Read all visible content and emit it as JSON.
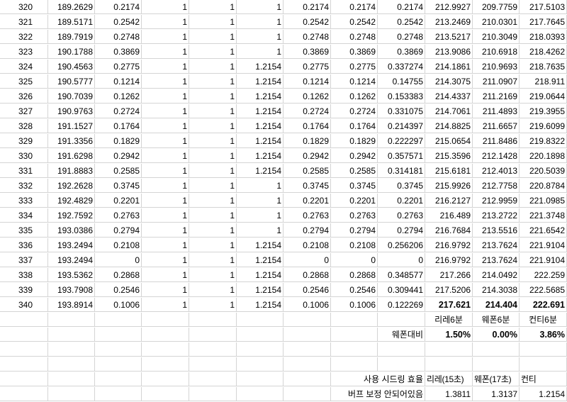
{
  "rows": [
    [
      "320",
      "189.2629",
      "0.2174",
      "1",
      "1",
      "1",
      "0.2174",
      "0.2174",
      "0.2174",
      "212.9927",
      "209.7759",
      "217.5103"
    ],
    [
      "321",
      "189.5171",
      "0.2542",
      "1",
      "1",
      "1",
      "0.2542",
      "0.2542",
      "0.2542",
      "213.2469",
      "210.0301",
      "217.7645"
    ],
    [
      "322",
      "189.7919",
      "0.2748",
      "1",
      "1",
      "1",
      "0.2748",
      "0.2748",
      "0.2748",
      "213.5217",
      "210.3049",
      "218.0393"
    ],
    [
      "323",
      "190.1788",
      "0.3869",
      "1",
      "1",
      "1",
      "0.3869",
      "0.3869",
      "0.3869",
      "213.9086",
      "210.6918",
      "218.4262"
    ],
    [
      "324",
      "190.4563",
      "0.2775",
      "1",
      "1",
      "1.2154",
      "0.2775",
      "0.2775",
      "0.337274",
      "214.1861",
      "210.9693",
      "218.7635"
    ],
    [
      "325",
      "190.5777",
      "0.1214",
      "1",
      "1",
      "1.2154",
      "0.1214",
      "0.1214",
      "0.14755",
      "214.3075",
      "211.0907",
      "218.911"
    ],
    [
      "326",
      "190.7039",
      "0.1262",
      "1",
      "1",
      "1.2154",
      "0.1262",
      "0.1262",
      "0.153383",
      "214.4337",
      "211.2169",
      "219.0644"
    ],
    [
      "327",
      "190.9763",
      "0.2724",
      "1",
      "1",
      "1.2154",
      "0.2724",
      "0.2724",
      "0.331075",
      "214.7061",
      "211.4893",
      "219.3955"
    ],
    [
      "328",
      "191.1527",
      "0.1764",
      "1",
      "1",
      "1.2154",
      "0.1764",
      "0.1764",
      "0.214397",
      "214.8825",
      "211.6657",
      "219.6099"
    ],
    [
      "329",
      "191.3356",
      "0.1829",
      "1",
      "1",
      "1.2154",
      "0.1829",
      "0.1829",
      "0.222297",
      "215.0654",
      "211.8486",
      "219.8322"
    ],
    [
      "330",
      "191.6298",
      "0.2942",
      "1",
      "1",
      "1.2154",
      "0.2942",
      "0.2942",
      "0.357571",
      "215.3596",
      "212.1428",
      "220.1898"
    ],
    [
      "331",
      "191.8883",
      "0.2585",
      "1",
      "1",
      "1.2154",
      "0.2585",
      "0.2585",
      "0.314181",
      "215.6181",
      "212.4013",
      "220.5039"
    ],
    [
      "332",
      "192.2628",
      "0.3745",
      "1",
      "1",
      "1",
      "0.3745",
      "0.3745",
      "0.3745",
      "215.9926",
      "212.7758",
      "220.8784"
    ],
    [
      "333",
      "192.4829",
      "0.2201",
      "1",
      "1",
      "1",
      "0.2201",
      "0.2201",
      "0.2201",
      "216.2127",
      "212.9959",
      "221.0985"
    ],
    [
      "334",
      "192.7592",
      "0.2763",
      "1",
      "1",
      "1",
      "0.2763",
      "0.2763",
      "0.2763",
      "216.489",
      "213.2722",
      "221.3748"
    ],
    [
      "335",
      "193.0386",
      "0.2794",
      "1",
      "1",
      "1",
      "0.2794",
      "0.2794",
      "0.2794",
      "216.7684",
      "213.5516",
      "221.6542"
    ],
    [
      "336",
      "193.2494",
      "0.2108",
      "1",
      "1",
      "1.2154",
      "0.2108",
      "0.2108",
      "0.256206",
      "216.9792",
      "213.7624",
      "221.9104"
    ],
    [
      "337",
      "193.2494",
      "0",
      "1",
      "1",
      "1.2154",
      "0",
      "0",
      "0",
      "216.9792",
      "213.7624",
      "221.9104"
    ],
    [
      "338",
      "193.5362",
      "0.2868",
      "1",
      "1",
      "1.2154",
      "0.2868",
      "0.2868",
      "0.348577",
      "217.266",
      "214.0492",
      "222.259"
    ],
    [
      "339",
      "193.7908",
      "0.2546",
      "1",
      "1",
      "1.2154",
      "0.2546",
      "0.2546",
      "0.309441",
      "217.5206",
      "214.3038",
      "222.5685"
    ],
    [
      "340",
      "193.8914",
      "0.1006",
      "1",
      "1",
      "1.2154",
      "0.1006",
      "0.1006",
      "0.122269",
      "217.621",
      "214.404",
      "222.691"
    ]
  ],
  "summary": {
    "labels_6min": [
      "리레6분",
      "웨폰6분",
      "컨티6분"
    ],
    "ratio_label": "웨폰대비",
    "ratios": [
      "1.50%",
      "0.00%",
      "3.86%"
    ],
    "efficiency_label": "사용 시드링 효율",
    "efficiency_names": [
      "리레(15초)",
      "웨폰(17초)",
      "컨티"
    ],
    "buff_label": "버프 보정 안되어있음",
    "efficiency_values": [
      "1.3811",
      "1.3137",
      "1.2154"
    ]
  }
}
